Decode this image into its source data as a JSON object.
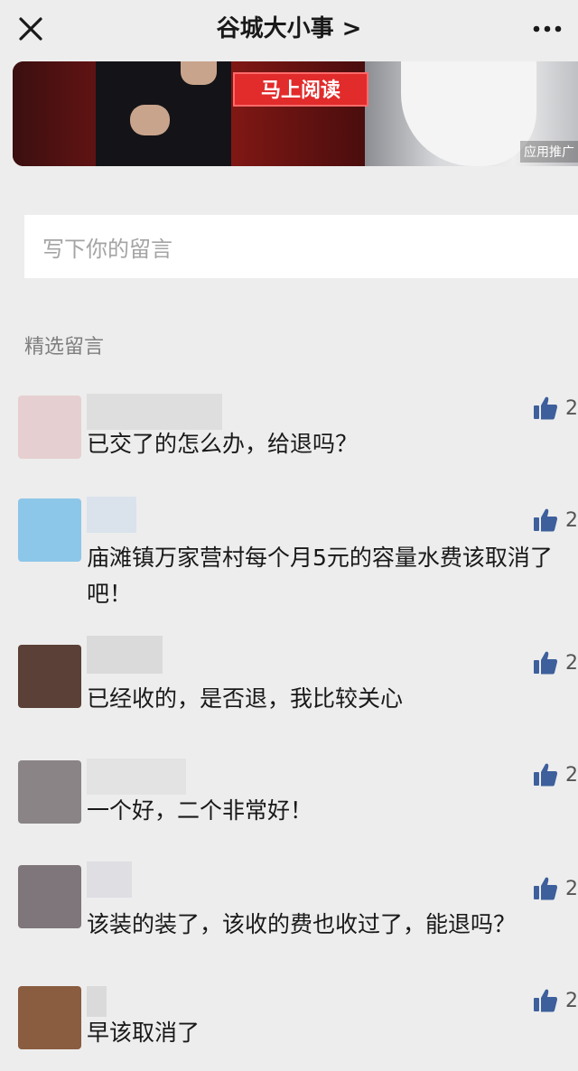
{
  "header": {
    "title": "谷城大小事 >"
  },
  "ad": {
    "button_label": "马上阅读",
    "tag": "应用推广"
  },
  "comment_input": {
    "placeholder": "写下你的留言"
  },
  "section": {
    "label": "精选留言"
  },
  "comments": [
    {
      "text": "已交了的怎么办，给退吗？",
      "likes": "2"
    },
    {
      "text": "庙滩镇万家营村每个月5元的容量水费该取消了吧！",
      "likes": "2"
    },
    {
      "text": "已经收的，是否退，我比较关心",
      "likes": "2"
    },
    {
      "text": "一个好，二个非常好！",
      "likes": "2"
    },
    {
      "text": "该装的装了，该收的费也收过了，能退吗？",
      "likes": "2"
    },
    {
      "text": "早该取消了",
      "likes": "2"
    }
  ],
  "colors": {
    "background": "#ededed",
    "accent_red": "#e22b2b",
    "like_icon": "#3d5f9c"
  },
  "icons": {
    "close": "close-icon",
    "more": "more-icon",
    "like": "thumbs-up-icon"
  }
}
